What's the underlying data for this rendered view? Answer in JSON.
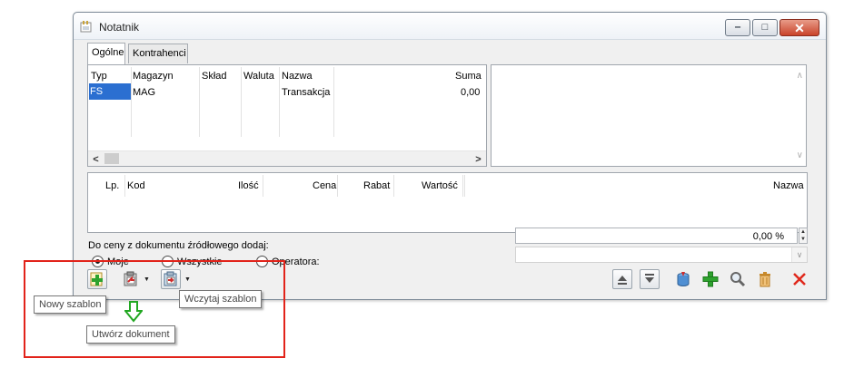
{
  "window": {
    "title": "Notatnik"
  },
  "tabs": [
    "Ogólne",
    "Kontrahenci"
  ],
  "documents": {
    "columns": [
      "Typ",
      "Magazyn",
      "Skład",
      "Waluta",
      "Nazwa",
      "Suma"
    ],
    "rows": [
      {
        "typ": "FS",
        "magazyn": "MAG",
        "sklad": "",
        "waluta": "",
        "nazwa": "Transakcja",
        "suma": "0,00"
      }
    ]
  },
  "lines": {
    "columns": [
      "Lp.",
      "Kod",
      "Ilość",
      "Cena",
      "Rabat",
      "Wartość",
      "Nazwa"
    ]
  },
  "price_source": {
    "label": "Do ceny z dokumentu źródłowego dodaj:",
    "options": [
      {
        "label": "Moje",
        "selected": true
      },
      {
        "label": "Wszystkie",
        "selected": false
      },
      {
        "label": "Operatora:",
        "selected": false
      }
    ],
    "percent_value": "0,00 %",
    "operator_value": ""
  },
  "tooltips": {
    "new_template": "Nowy szablon",
    "load_template": "Wczytaj szablon",
    "create_document": "Utwórz dokument"
  },
  "colors": {
    "highlight": "#2b6fd1",
    "annotation_box": "#e2231a",
    "annotation_arrow": "#22a722"
  }
}
